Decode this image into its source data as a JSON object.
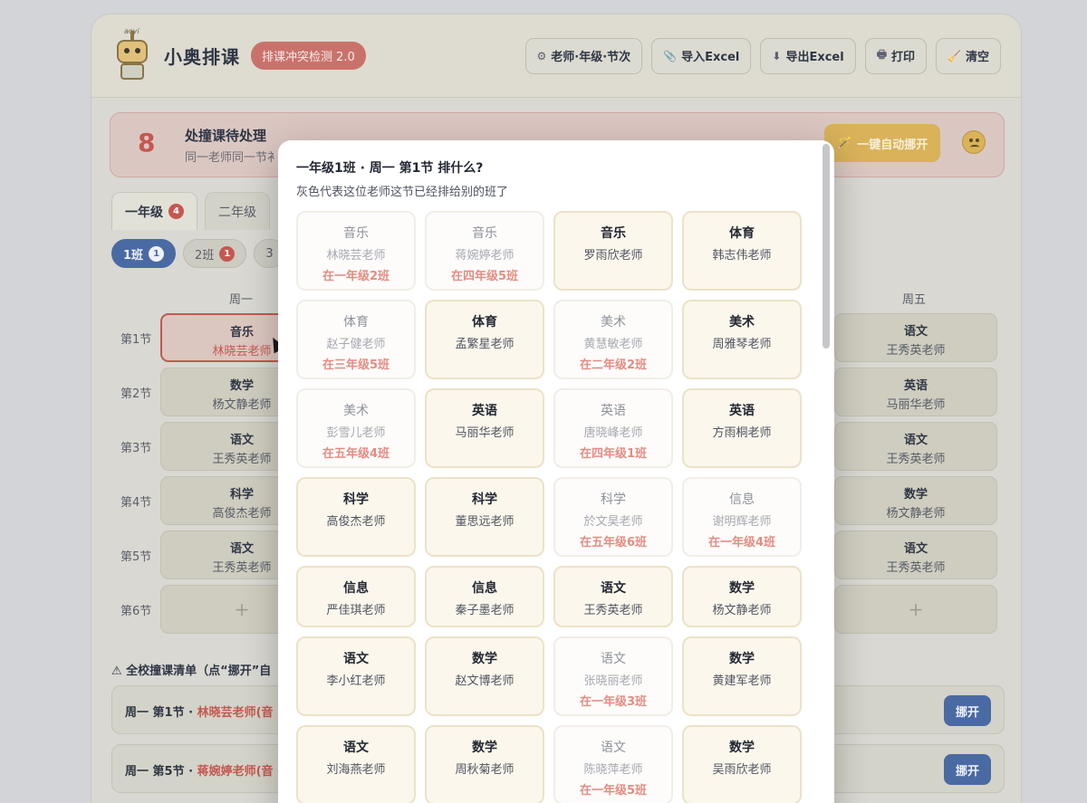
{
  "app": {
    "mascot_text": "aoyi",
    "brand": "小奥排课",
    "version_badge": "排课冲突检测 2.0"
  },
  "toolbar": [
    {
      "name": "teacher-grade-period-button",
      "icon": "⚙",
      "label": "老师·年级·节次"
    },
    {
      "name": "import-excel-button",
      "icon": "📎",
      "label": "导入Excel"
    },
    {
      "name": "export-excel-button",
      "icon": "⬇",
      "label": "导出Excel"
    },
    {
      "name": "print-button",
      "icon": "🖶",
      "label": "打印"
    },
    {
      "name": "clear-button",
      "icon": "🧹",
      "label": "清空"
    }
  ],
  "conflict_banner": {
    "count": "8",
    "title": "处撞课待处理",
    "subtitle": "同一老师同一节衤",
    "auto_button": "一键自动挪开",
    "auto_icon": "🪄",
    "face_icon": "worried-face-icon"
  },
  "grade_tabs": [
    {
      "label": "一年级",
      "badge": "4",
      "active": true
    },
    {
      "label": "二年级",
      "badge": "",
      "active": false
    }
  ],
  "class_pills": [
    {
      "label": "1班",
      "badge": "1",
      "active": true
    },
    {
      "label": "2班",
      "badge": "1",
      "active": false
    },
    {
      "label": "3",
      "badge": "",
      "active": false
    }
  ],
  "timetable": {
    "days": [
      "周一",
      "周五"
    ],
    "periods": [
      "第1节",
      "第2节",
      "第3节",
      "第4节",
      "第5节",
      "第6节"
    ],
    "monday": [
      {
        "subject": "音乐",
        "teacher": "林晓芸老师",
        "conflict": true
      },
      {
        "subject": "数学",
        "teacher": "杨文静老师"
      },
      {
        "subject": "语文",
        "teacher": "王秀英老师"
      },
      {
        "subject": "科学",
        "teacher": "高俊杰老师"
      },
      {
        "subject": "语文",
        "teacher": "王秀英老师"
      },
      {
        "subject": "",
        "teacher": "",
        "empty": true,
        "plus": "+"
      }
    ],
    "friday": [
      {
        "subject": "语文",
        "teacher": "王秀英老师"
      },
      {
        "subject": "英语",
        "teacher": "马丽华老师"
      },
      {
        "subject": "语文",
        "teacher": "王秀英老师"
      },
      {
        "subject": "数学",
        "teacher": "杨文静老师"
      },
      {
        "subject": "语文",
        "teacher": "王秀英老师"
      },
      {
        "subject": "",
        "teacher": "",
        "empty": true,
        "plus": "+"
      }
    ]
  },
  "conflict_list": {
    "title": "⚠ 全校撞课清单（点“挪开”自",
    "rows": [
      {
        "prefix": "周一 第1节 · ",
        "who": "林晓芸老师(音",
        "button": "挪开"
      },
      {
        "prefix": "周一 第5节 · ",
        "who": "蒋婉婷老师(音",
        "button": "挪开"
      }
    ]
  },
  "modal": {
    "title": "一年级1班 · 周一 第1节 排什么?",
    "subtitle": "灰色代表这位老师这节已经排给别的班了",
    "options": [
      {
        "subject": "音乐",
        "teacher": "林晓芸老师",
        "busy": "在一年级2班"
      },
      {
        "subject": "音乐",
        "teacher": "蒋婉婷老师",
        "busy": "在四年级5班"
      },
      {
        "subject": "音乐",
        "teacher": "罗雨欣老师",
        "busy": ""
      },
      {
        "subject": "体育",
        "teacher": "韩志伟老师",
        "busy": ""
      },
      {
        "subject": "体育",
        "teacher": "赵子健老师",
        "busy": "在三年级5班"
      },
      {
        "subject": "体育",
        "teacher": "孟繁星老师",
        "busy": ""
      },
      {
        "subject": "美术",
        "teacher": "黄慧敏老师",
        "busy": "在二年级2班"
      },
      {
        "subject": "美术",
        "teacher": "周雅琴老师",
        "busy": ""
      },
      {
        "subject": "美术",
        "teacher": "彭雪儿老师",
        "busy": "在五年级4班"
      },
      {
        "subject": "英语",
        "teacher": "马丽华老师",
        "busy": ""
      },
      {
        "subject": "英语",
        "teacher": "唐晓峰老师",
        "busy": "在四年级1班"
      },
      {
        "subject": "英语",
        "teacher": "方雨桐老师",
        "busy": ""
      },
      {
        "subject": "科学",
        "teacher": "高俊杰老师",
        "busy": ""
      },
      {
        "subject": "科学",
        "teacher": "董思远老师",
        "busy": ""
      },
      {
        "subject": "科学",
        "teacher": "於文昊老师",
        "busy": "在五年级6班"
      },
      {
        "subject": "信息",
        "teacher": "谢明辉老师",
        "busy": "在一年级4班"
      },
      {
        "subject": "信息",
        "teacher": "严佳琪老师",
        "busy": ""
      },
      {
        "subject": "信息",
        "teacher": "秦子墨老师",
        "busy": ""
      },
      {
        "subject": "语文",
        "teacher": "王秀英老师",
        "busy": ""
      },
      {
        "subject": "数学",
        "teacher": "杨文静老师",
        "busy": ""
      },
      {
        "subject": "语文",
        "teacher": "李小红老师",
        "busy": ""
      },
      {
        "subject": "数学",
        "teacher": "赵文博老师",
        "busy": ""
      },
      {
        "subject": "语文",
        "teacher": "张晓丽老师",
        "busy": "在一年级3班"
      },
      {
        "subject": "数学",
        "teacher": "黄建军老师",
        "busy": ""
      },
      {
        "subject": "语文",
        "teacher": "刘海燕老师",
        "busy": ""
      },
      {
        "subject": "数学",
        "teacher": "周秋菊老师",
        "busy": ""
      },
      {
        "subject": "语文",
        "teacher": "陈晓萍老师",
        "busy": "在一年级5班"
      },
      {
        "subject": "数学",
        "teacher": "吴雨欣老师",
        "busy": ""
      }
    ]
  }
}
